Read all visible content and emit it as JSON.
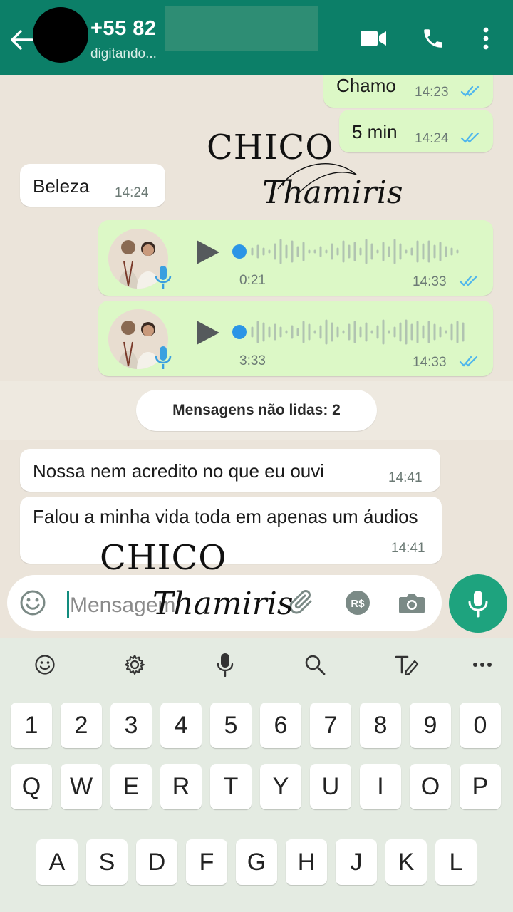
{
  "header": {
    "contact_name": "+55 82",
    "status": "digitando...",
    "icons": [
      "back-arrow-icon",
      "video-call-icon",
      "phone-icon",
      "more-vert-icon"
    ],
    "color": "#0c7f68"
  },
  "messages": [
    {
      "type": "text",
      "dir": "out",
      "text": "Chamo",
      "time": "14:23",
      "status": "read"
    },
    {
      "type": "text",
      "dir": "out",
      "text": "5 min",
      "time": "14:24",
      "status": "read"
    },
    {
      "type": "text",
      "dir": "in",
      "text": "Beleza",
      "time": "14:24"
    },
    {
      "type": "voice",
      "dir": "out",
      "duration": "0:21",
      "time": "14:33",
      "status": "read"
    },
    {
      "type": "voice",
      "dir": "out",
      "duration": "3:33",
      "time": "14:33",
      "status": "read"
    },
    {
      "type": "text",
      "dir": "in",
      "text": "Nossa nem acredito no que eu ouvi",
      "time": "14:41"
    },
    {
      "type": "text",
      "dir": "in",
      "text": "Falou a minha vida toda em apenas um áudios",
      "time": "14:41"
    }
  ],
  "unread_label": "Mensagens não lidas: 2",
  "watermark": {
    "line1": "CHICO",
    "line2": "Thamiris"
  },
  "composer": {
    "placeholder": "Mensagem",
    "icons": [
      "emoji-icon",
      "attach-icon",
      "payment-icon",
      "camera-icon",
      "mic-icon"
    ]
  },
  "keyboard": {
    "toolbar": [
      "emoji-icon",
      "settings-icon",
      "voice-input-icon",
      "search-icon",
      "handwriting-icon",
      "more-icon"
    ],
    "row_numbers": [
      "1",
      "2",
      "3",
      "4",
      "5",
      "6",
      "7",
      "8",
      "9",
      "0"
    ],
    "row_top": [
      "Q",
      "W",
      "E",
      "R",
      "T",
      "Y",
      "U",
      "I",
      "O",
      "P"
    ],
    "row_home": [
      "A",
      "S",
      "D",
      "F",
      "G",
      "H",
      "J",
      "K",
      "L"
    ]
  },
  "colors": {
    "outgoing": "#dcf8c6",
    "incoming": "#ffffff",
    "read_ticks": "#4fb6ec",
    "accent": "#1ea37e"
  }
}
